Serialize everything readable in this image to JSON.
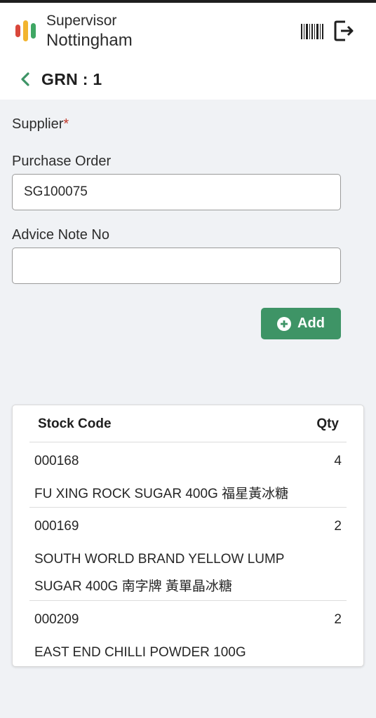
{
  "header": {
    "role": "Supervisor",
    "site": "Nottingham",
    "icons": [
      "barcode-icon",
      "logout-icon"
    ]
  },
  "page": {
    "title": "GRN : 1"
  },
  "form": {
    "supplier_label": "Supplier",
    "required_marker": "*",
    "purchase_order_label": "Purchase Order",
    "purchase_order_value": "SG100075",
    "advice_note_label": "Advice Note No",
    "advice_note_value": "",
    "add_button_label": "Add"
  },
  "table": {
    "headers": {
      "code": "Stock Code",
      "qty": "Qty"
    },
    "rows": [
      {
        "code": "000168",
        "qty": "4",
        "description": "FU XING ROCK SUGAR 400G 福星黃冰糖"
      },
      {
        "code": "000169",
        "qty": "2",
        "description": "SOUTH WORLD BRAND YELLOW LUMP SUGAR 400G 南字牌 黃單晶冰糖"
      },
      {
        "code": "000209",
        "qty": "2",
        "description": "EAST END CHILLI POWDER 100G"
      }
    ]
  },
  "colors": {
    "accent": "#3e9466",
    "required": "#c0392b",
    "background": "#f0f2f5"
  }
}
